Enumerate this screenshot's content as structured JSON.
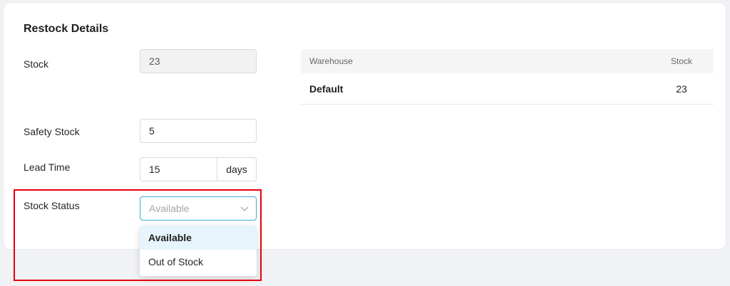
{
  "section": {
    "title": "Restock Details"
  },
  "fields": {
    "stock": {
      "label": "Stock",
      "value": "23"
    },
    "safety_stock": {
      "label": "Safety Stock",
      "value": "5"
    },
    "lead_time": {
      "label": "Lead Time",
      "value": "15",
      "unit": "days"
    },
    "stock_status": {
      "label": "Stock Status",
      "placeholder": "Available",
      "options": [
        "Available",
        "Out of Stock"
      ],
      "highlighted_option": "Available"
    }
  },
  "warehouse_table": {
    "headers": [
      "Warehouse",
      "Stock"
    ],
    "rows": [
      {
        "warehouse": "Default",
        "stock": "23"
      }
    ]
  },
  "colors": {
    "highlight_box": "#e8000b",
    "select_focus_border": "#40a9d9",
    "option_hover_bg": "#e6f4fb"
  },
  "icons": {
    "select_arrow": "chevron-down-icon"
  }
}
